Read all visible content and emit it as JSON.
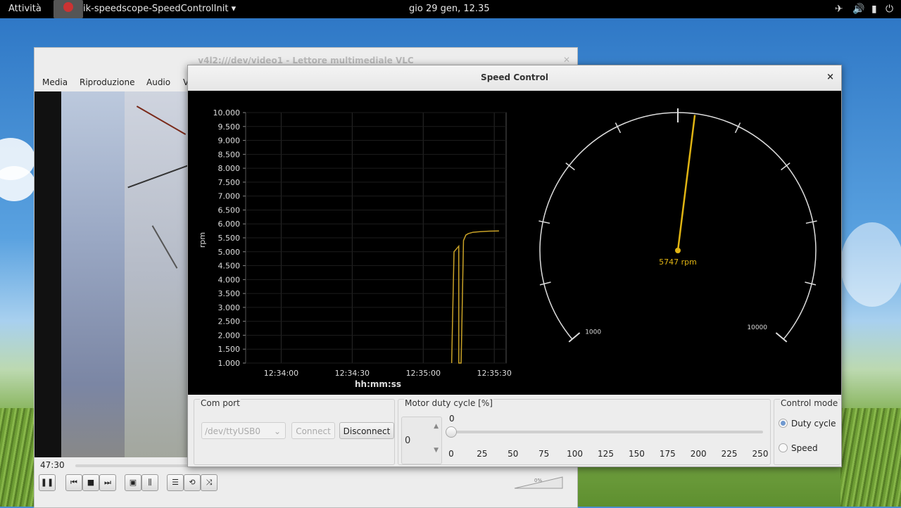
{
  "topbar": {
    "activities": "Attività",
    "app_name": "ik-speedscope-SpeedControlInit ▾",
    "clock": "gio 29 gen, 12.35",
    "icons": [
      "airplane-icon",
      "volume-icon",
      "battery-icon",
      "power-menu-icon"
    ]
  },
  "vlc": {
    "title": "v4l2:///dev/video1 - Lettore multimediale VLC",
    "menu": [
      "Media",
      "Riproduzione",
      "Audio",
      "V"
    ],
    "time": "47:30",
    "volume_label": "0%"
  },
  "speed_control": {
    "title": "Speed Control",
    "close_glyph": "×",
    "gauge": {
      "value": 5747,
      "label": "5747 rpm",
      "min": 1000,
      "max": 10000,
      "min_label": "1000",
      "max_label": "10000",
      "needle_color": "#e0b413"
    },
    "com_port": {
      "label": "Com port",
      "selected": "/dev/ttyUSB0",
      "connect": "Connect",
      "disconnect": "Disconnect"
    },
    "motor": {
      "label": "Motor duty cycle [%]",
      "spin_value": "0",
      "slider_value": "0",
      "slider_fraction": 0,
      "ticks": [
        "0",
        "25",
        "50",
        "75",
        "100",
        "125",
        "150",
        "175",
        "200",
        "225",
        "250"
      ]
    },
    "control_mode": {
      "label": "Control mode",
      "options": [
        "Duty cycle",
        "Speed"
      ],
      "selected": "Duty cycle"
    }
  },
  "chart_data": {
    "type": "line",
    "title": "",
    "xlabel": "hh:mm:ss",
    "ylabel": "rpm",
    "ylim": [
      1000,
      10000
    ],
    "yticks": [
      "1.000",
      "1.500",
      "2.000",
      "2.500",
      "3.000",
      "3.500",
      "4.000",
      "4.500",
      "5.000",
      "5.500",
      "6.000",
      "6.500",
      "7.000",
      "7.500",
      "8.000",
      "8.500",
      "9.000",
      "9.500",
      "10.000"
    ],
    "xticks": [
      "12:34:00",
      "12:34:30",
      "12:35:00",
      "12:35:30"
    ],
    "grid": true,
    "series": [
      {
        "color": "#c9a227",
        "x": [
          "12:35:12",
          "12:35:13",
          "12:35:14",
          "12:35:15",
          "12:35:15",
          "12:35:16",
          "12:35:17",
          "12:35:18",
          "12:35:19",
          "12:35:21",
          "12:35:24",
          "12:35:28",
          "12:35:32"
        ],
        "y": [
          1000,
          5000,
          5100,
          5200,
          1000,
          1000,
          5400,
          5600,
          5650,
          5700,
          5720,
          5740,
          5747
        ]
      }
    ]
  }
}
